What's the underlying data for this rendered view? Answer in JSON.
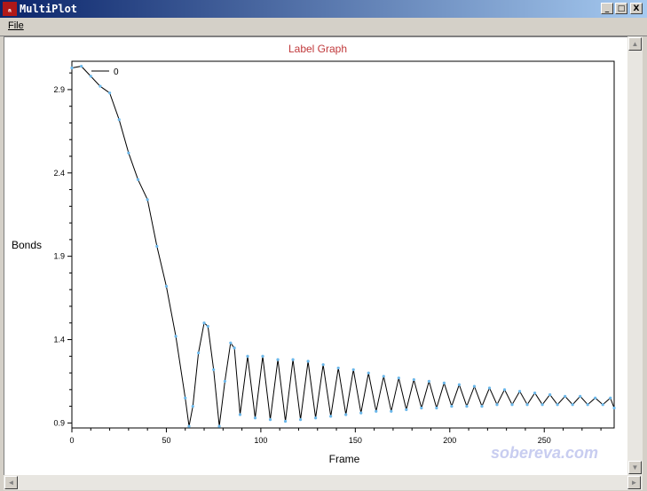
{
  "window": {
    "title": "MultiPlot",
    "icon": "multiplot-app-icon"
  },
  "controls": {
    "minimize": "_",
    "maximize": "□",
    "close": "X"
  },
  "menu": {
    "file_label": "File"
  },
  "icons": {
    "scroll_up": "▲",
    "scroll_down": "▼",
    "scroll_left": "◄",
    "scroll_right": "►"
  },
  "colors": {
    "title": "#c0393b",
    "line": "#000000",
    "markers": "#6ab7ea",
    "watermark": "#c8cdf0"
  },
  "watermark": "sobereva.com",
  "chart_data": {
    "type": "line",
    "title": "Label Graph",
    "xlabel": "Frame",
    "ylabel": "Bonds",
    "xlim": [
      0,
      287
    ],
    "ylim": [
      0.87,
      3.07
    ],
    "x_ticks": [
      0,
      50,
      100,
      150,
      200,
      250
    ],
    "y_ticks": [
      0.9,
      1.4,
      1.9,
      2.4,
      2.9
    ],
    "legend": {
      "entries": [
        "0"
      ],
      "placement": "top-left"
    },
    "series": [
      {
        "name": "0",
        "x": [
          0,
          5,
          10,
          15,
          20,
          25,
          30,
          35,
          40,
          45,
          50,
          55,
          60,
          62,
          64,
          67,
          70,
          72,
          75,
          78,
          81,
          84,
          86,
          89,
          93,
          97,
          101,
          105,
          109,
          113,
          117,
          121,
          125,
          129,
          133,
          137,
          141,
          145,
          149,
          153,
          157,
          161,
          165,
          169,
          173,
          177,
          181,
          185,
          189,
          193,
          197,
          201,
          205,
          209,
          213,
          217,
          221,
          225,
          229,
          233,
          237,
          241,
          245,
          249,
          253,
          257,
          261,
          265,
          269,
          273,
          277,
          281,
          285,
          287
        ],
        "y": [
          3.03,
          3.04,
          2.98,
          2.92,
          2.88,
          2.72,
          2.52,
          2.36,
          2.24,
          1.96,
          1.72,
          1.42,
          1.05,
          0.88,
          1.0,
          1.32,
          1.5,
          1.48,
          1.22,
          0.88,
          1.15,
          1.38,
          1.35,
          0.95,
          1.3,
          0.93,
          1.3,
          0.92,
          1.28,
          0.91,
          1.28,
          0.92,
          1.27,
          0.93,
          1.25,
          0.94,
          1.23,
          0.95,
          1.22,
          0.96,
          1.2,
          0.97,
          1.18,
          0.97,
          1.17,
          0.98,
          1.16,
          0.99,
          1.15,
          0.99,
          1.14,
          1.0,
          1.13,
          1.0,
          1.12,
          1.0,
          1.11,
          1.01,
          1.1,
          1.01,
          1.09,
          1.01,
          1.08,
          1.01,
          1.07,
          1.01,
          1.06,
          1.01,
          1.06,
          1.01,
          1.05,
          1.01,
          1.05,
          0.99
        ]
      }
    ]
  }
}
